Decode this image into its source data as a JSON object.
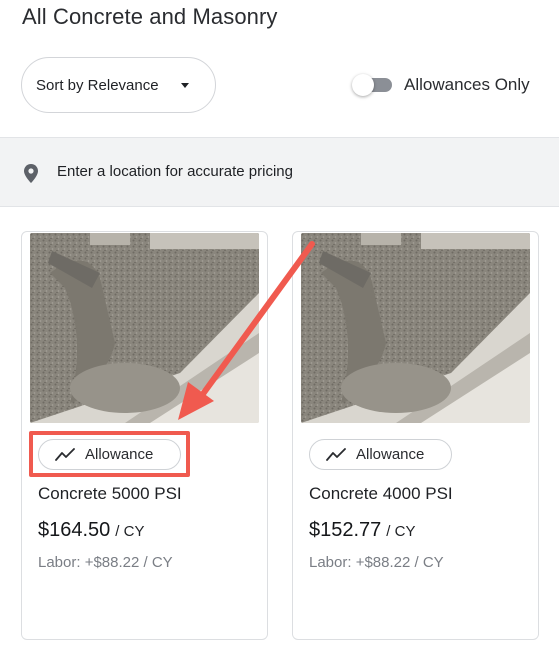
{
  "page": {
    "title": "All Concrete and Masonry"
  },
  "sort": {
    "label": "Sort by Relevance"
  },
  "filter": {
    "allowances_label": "Allowances Only",
    "allowances_on": false
  },
  "location": {
    "prompt": "Enter a location for accurate pricing"
  },
  "products": [
    {
      "badge": "Allowance",
      "name": "Concrete 5000 PSI",
      "price": "$164.50",
      "unit": "/ CY",
      "labor": "Labor: +$88.22 / CY"
    },
    {
      "badge": "Allowance",
      "name": "Concrete 4000 PSI",
      "price": "$152.77",
      "unit": "/ CY",
      "labor": "Labor: +$88.22 / CY"
    }
  ],
  "icons": {
    "caret": "caret-down-icon",
    "pin": "location-pin-icon",
    "badge": "trend-line-icon"
  },
  "colors": {
    "annotation": "#f05a4f",
    "location_bar": "#f2f3f4",
    "toggle_off": "#8b8f96"
  }
}
